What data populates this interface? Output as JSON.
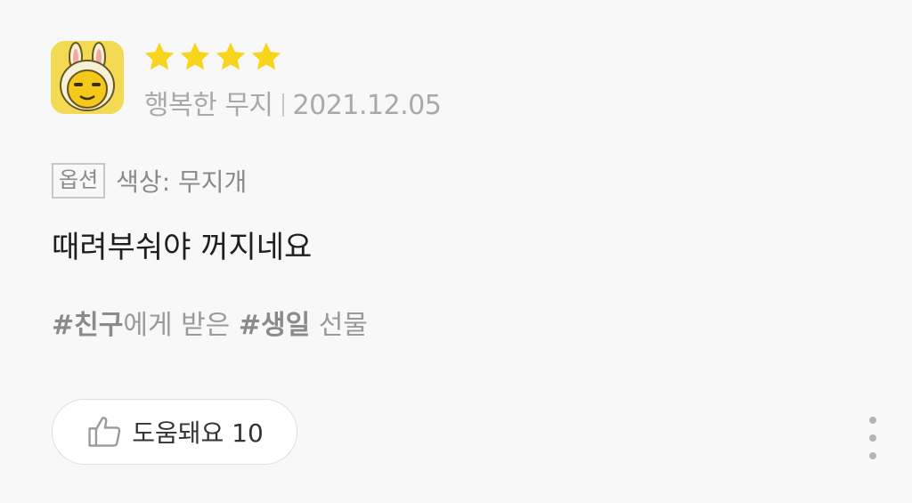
{
  "review": {
    "rating": 4,
    "rating_max": 4,
    "author": "행복한 무지",
    "date": "2021.12.05",
    "option_label": "옵션",
    "option_value": "색상: 무지개",
    "text": "때려부숴야 꺼지네요",
    "tags": {
      "tag1": "#친구",
      "text1": "에게 받은 ",
      "tag2": "#생일",
      "text2": " 선물"
    },
    "helpful_label": "도움돼요 10"
  },
  "colors": {
    "star": "#f7d51d",
    "avatar_bg": "#f2d54a",
    "avatar_face": "#f5cc1a"
  },
  "icons": {
    "avatar": "ryan-muzi-character-avatar",
    "star": "star-icon",
    "thumb": "thumbs-up-icon",
    "more": "more-vertical-icon"
  }
}
